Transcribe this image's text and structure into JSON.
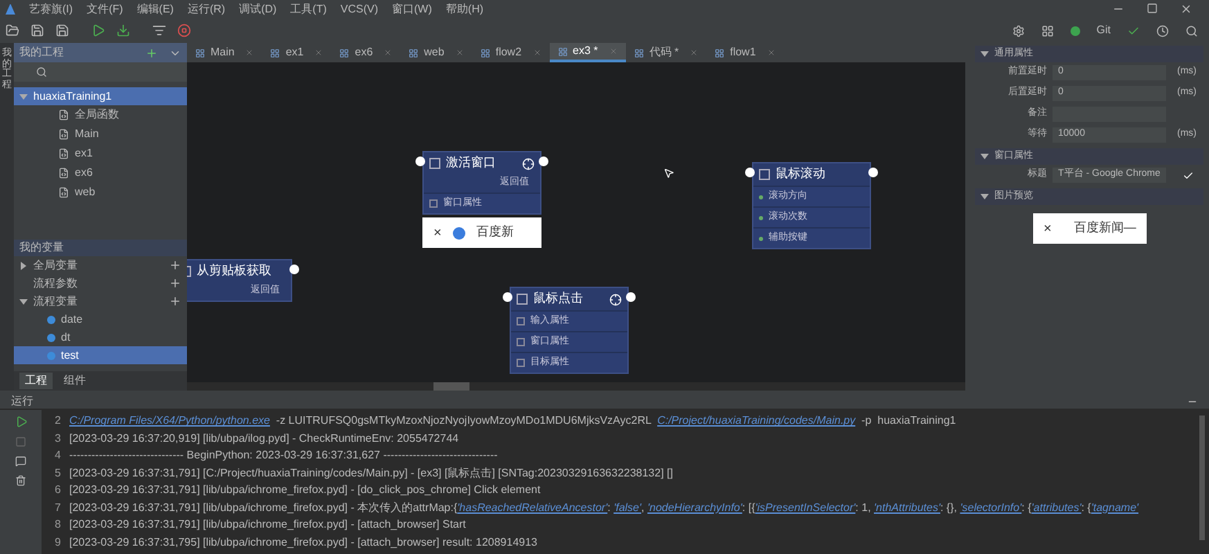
{
  "menu": [
    "艺赛旗(I)",
    "文件(F)",
    "编辑(E)",
    "运行(R)",
    "调试(D)",
    "工具(T)",
    "VCS(V)",
    "窗口(W)",
    "帮助(H)"
  ],
  "toolbar_right": {
    "git": "Git"
  },
  "side_strip": {
    "label": "我的工程"
  },
  "project": {
    "title": "我的工程",
    "tree": [
      {
        "label": "huaxiaTraining1",
        "expanded": true,
        "selected": true,
        "children": [
          {
            "label": "全局函数",
            "selected": false
          },
          {
            "label": "Main",
            "selected": false
          },
          {
            "label": "ex1",
            "selected": false
          },
          {
            "label": "ex6",
            "selected": false
          },
          {
            "label": "web",
            "selected": false
          }
        ]
      }
    ]
  },
  "variables": {
    "title": "我的变量",
    "items": [
      {
        "label": "全局变量",
        "expanded": false,
        "selected": false
      },
      {
        "label": "流程参数",
        "selected": false
      },
      {
        "label": "流程变量",
        "expanded": true,
        "selected": false,
        "children": [
          {
            "label": "date",
            "selected": false
          },
          {
            "label": "dt",
            "selected": false
          },
          {
            "label": "test",
            "selected": true
          }
        ]
      }
    ]
  },
  "panel_tabs": [
    {
      "label": "工程",
      "selected": true
    },
    {
      "label": "组件",
      "selected": false
    }
  ],
  "tabs": [
    {
      "label": "Main",
      "selected": false
    },
    {
      "label": "ex1",
      "selected": false
    },
    {
      "label": "ex6",
      "selected": false
    },
    {
      "label": "web",
      "selected": false
    },
    {
      "label": "flow2",
      "selected": false
    },
    {
      "label": "ex3 *",
      "selected": true
    },
    {
      "label": "代码 *",
      "selected": false
    },
    {
      "label": "flow1",
      "selected": false
    }
  ],
  "nodes": [
    {
      "title": "激活窗口",
      "target": true,
      "outputs": [
        "返回值"
      ],
      "rows": [
        {
          "label": "窗口属性",
          "kind": "group"
        }
      ],
      "preview": {
        "close": "×",
        "title": "百度新"
      }
    },
    {
      "title": "从剪贴板获取",
      "target": false,
      "outputs": [
        "返回值"
      ]
    },
    {
      "title": "鼠标点击",
      "target": true,
      "rows": [
        {
          "label": "输入属性",
          "kind": "group"
        },
        {
          "label": "窗口属性",
          "kind": "group"
        },
        {
          "label": "目标属性",
          "kind": "group"
        }
      ]
    },
    {
      "title": "鼠标滚动",
      "target": false,
      "rows": [
        {
          "label": "滚动方向",
          "kind": "input"
        },
        {
          "label": "滚动次数",
          "kind": "input"
        },
        {
          "label": "辅助按键",
          "kind": "input"
        }
      ]
    }
  ],
  "properties": {
    "sections": [
      {
        "title": "通用属性",
        "fields": [
          {
            "label": "前置延时",
            "value": "0",
            "unit": "(ms)"
          },
          {
            "label": "后置延时",
            "value": "0",
            "unit": "(ms)"
          },
          {
            "label": "备注"
          },
          {
            "label": "等待",
            "value": "10000",
            "unit": "(ms)"
          }
        ]
      },
      {
        "title": "窗口属性",
        "fields": [
          {
            "label": "标题",
            "value": "T平台 - Google Chrome",
            "checked": true
          }
        ]
      },
      {
        "title": "图片预览",
        "preview": {
          "close": "×",
          "title": "百度新闻—"
        }
      }
    ]
  },
  "console": {
    "title": "运行",
    "lines": [
      {
        "number": "2",
        "segments": [
          {
            "text": "C:/Program Files/X64/Python/python.exe",
            "link": true
          },
          {
            "text": "  -z LUITRUFSQ0gsMTkyMzoxNjozNyojIyowMzoyMDo1MDU6MjksVzAyc2RL  ",
            "link": false
          },
          {
            "text": "C:/Project/huaxiaTraining/codes/Main.py",
            "link": true
          },
          {
            "text": "  -p  huaxiaTraining1",
            "link": false
          }
        ]
      },
      {
        "number": "3",
        "segments": [
          {
            "text": "[2023-03-29 16:37:20,919] [lib/ubpa/ilog.pyd] - CheckRuntimeEnv: 2055472744",
            "link": false
          }
        ]
      },
      {
        "number": "4",
        "segments": [
          {
            "text": "------------------------------- BeginPython: 2023-03-29 16:37:31,627 -------------------------------",
            "link": false
          }
        ]
      },
      {
        "number": "5",
        "segments": [
          {
            "text": "[2023-03-29 16:37:31,791] [C:/Project/huaxiaTraining/codes/Main.py] - [ex3] [鼠标点击] [SNTag:20230329163632238132] []",
            "link": false
          }
        ]
      },
      {
        "number": "6",
        "segments": [
          {
            "text": "[2023-03-29 16:37:31,791] [lib/ubpa/ichrome_firefox.pyd] - [do_click_pos_chrome] Click element",
            "link": false
          }
        ]
      },
      {
        "number": "7",
        "segments": [
          {
            "text": "[2023-03-29 16:37:31,791] [lib/ubpa/ichrome_firefox.pyd] - 本次传入的attrMap:{",
            "link": false
          },
          {
            "text": "'hasReachedRelativeAncestor'",
            "link": true
          },
          {
            "text": ": ",
            "link": false
          },
          {
            "text": "'false'",
            "link": true
          },
          {
            "text": ", ",
            "link": false
          },
          {
            "text": "'nodeHierarchyInfo'",
            "link": true
          },
          {
            "text": ": [{",
            "link": false
          },
          {
            "text": "'isPresentInSelector'",
            "link": true
          },
          {
            "text": ": 1, ",
            "link": false
          },
          {
            "text": "'nthAttributes'",
            "link": true
          },
          {
            "text": ": {}, ",
            "link": false
          },
          {
            "text": "'selectorInfo'",
            "link": true
          },
          {
            "text": ": {",
            "link": false
          },
          {
            "text": "'attributes'",
            "link": true
          },
          {
            "text": ": {",
            "link": false
          },
          {
            "text": "'tagname'",
            "link": true
          }
        ]
      },
      {
        "number": "8",
        "segments": [
          {
            "text": "[2023-03-29 16:37:31,791] [lib/ubpa/ichrome_firefox.pyd] - [attach_browser] Start",
            "link": false
          }
        ]
      },
      {
        "number": "9",
        "segments": [
          {
            "text": "[2023-03-29 16:37:31,795] [lib/ubpa/ichrome_firefox.pyd] - [attach_browser] result: 1208914913",
            "link": false
          }
        ]
      }
    ]
  }
}
